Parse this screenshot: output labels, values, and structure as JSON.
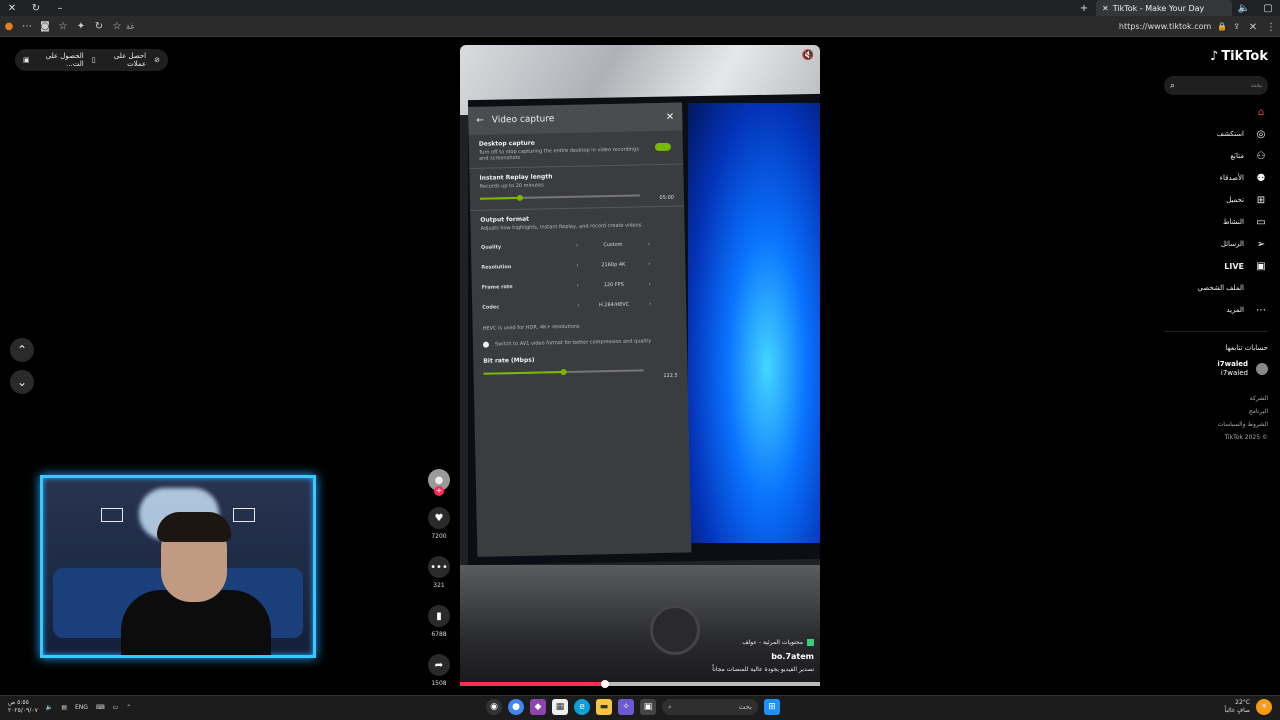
{
  "browser": {
    "tab_title": "TikTok - Make Your Day",
    "url": "https://www.tiktok.com",
    "address_hint": "غة"
  },
  "promo": {
    "get_app": "احصل على عملات",
    "get_pc": "الحصول على الت..."
  },
  "video": {
    "panel": {
      "title": "Video capture",
      "desktop_capture_title": "Desktop capture",
      "desktop_capture_desc": "Turn off to stop capturing the entire desktop in video recordings and screenshots",
      "replay_title": "Instant Replay length",
      "replay_desc": "Records up to 20 minutes",
      "replay_value": "05:00",
      "replay_fraction": 0.25,
      "output_title": "Output format",
      "output_desc": "Adjusts how highlights, Instant Replay, and record create videos.",
      "rows": [
        {
          "label": "Quality",
          "value": "Custom"
        },
        {
          "label": "Resolution",
          "value": "2160p 4K"
        },
        {
          "label": "Frame rate",
          "value": "120 FPS"
        },
        {
          "label": "Codec",
          "value": "H.264/HEVC"
        }
      ],
      "hevc_note": "HEVC is used for HDR, 4K+ resolutions",
      "av1_option": "Switch to AV1 video format for better compression and quality",
      "bitrate_title": "Bit rate (Mbps)",
      "bitrate_value": "122.5",
      "bitrate_fraction": 0.5
    },
    "caption": {
      "tag": "محتويات المرئية - عولف",
      "username": "bo.7atem",
      "description": "تصدير الفيديو بجودة عالية للمنصات مجاناً"
    },
    "progress_fraction": 0.4
  },
  "actions": {
    "likes": "7200",
    "comments": "321",
    "saves": "6788",
    "shares": "1508"
  },
  "sidebar": {
    "logo": "TikTok",
    "search_placeholder": "بحث",
    "nav": [
      {
        "label": "",
        "icon": "home-icon"
      },
      {
        "label": "استكشف",
        "icon": "compass-icon"
      },
      {
        "label": "متابَع",
        "icon": "user-plus-icon"
      },
      {
        "label": "الأصدقاء",
        "icon": "friends-icon"
      },
      {
        "label": "تحميل",
        "icon": "upload-icon"
      },
      {
        "label": "النشاط",
        "icon": "activity-icon"
      },
      {
        "label": "الرسائل",
        "icon": "messages-icon"
      },
      {
        "label": "LIVE",
        "icon": "live-icon"
      },
      {
        "label": "الملف الشخصي",
        "icon": "profile-icon"
      },
      {
        "label": "المزيد",
        "icon": "more-icon"
      }
    ],
    "following_title": "حسابات تتابعها",
    "following": [
      {
        "name": "i7waled",
        "handle": "i7waled"
      }
    ],
    "footer": [
      "الشركة",
      "البرنامج",
      "الشروط والسياسات",
      "© 2025 TikTok"
    ]
  },
  "taskbar": {
    "time": "٥:٥٥ ص",
    "date": "٢٠٢٥/٠٩/٠٧",
    "lang": "ENG",
    "search": "بحث",
    "weather_temp": "22°C",
    "weather_desc": "صافٍ غالباً"
  },
  "colors": {
    "accent": "#fe2c55",
    "nvidia_green": "#76b900",
    "webcam_border": "#38c9ff"
  }
}
